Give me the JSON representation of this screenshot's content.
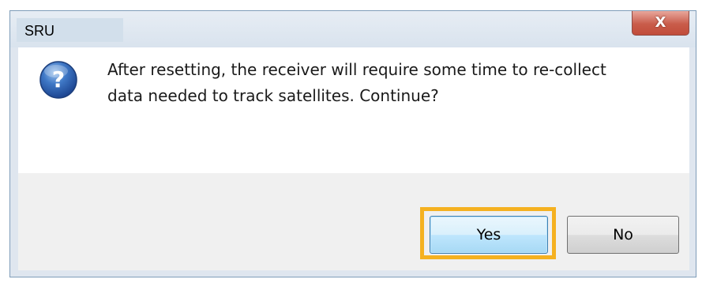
{
  "dialog": {
    "title": "SRU",
    "close_glyph": "X",
    "icon": "question-icon",
    "message_line1": "After resetting, the receiver will require some time to re-collect",
    "message_line2": "data needed to track satellites. Continue?",
    "yes_label": "Yes",
    "no_label": "No",
    "highlight_color": "#f5b120",
    "close_color": "#c95c4a"
  }
}
